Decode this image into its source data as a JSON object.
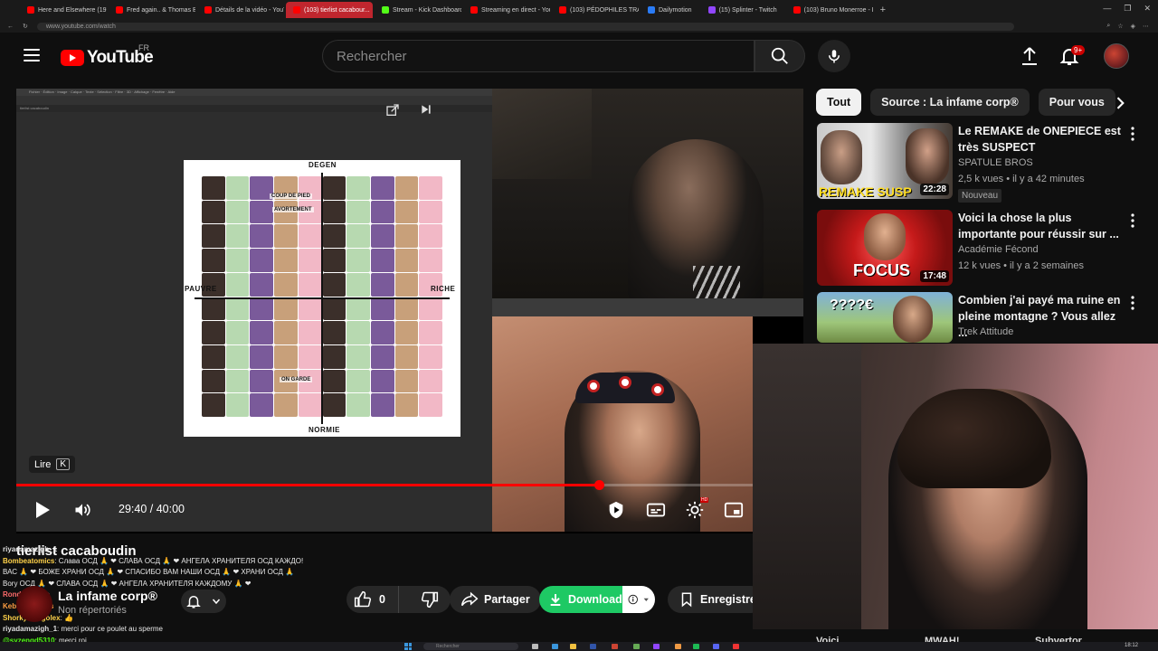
{
  "browser": {
    "tabs": [
      {
        "label": "Here and Elsewhere (197...",
        "icon": "youtube-favicon"
      },
      {
        "label": "Fred again.. & Thomas Ba...",
        "icon": "youtube-favicon"
      },
      {
        "label": "Détails de la vidéo - YouT...",
        "icon": "youtube-favicon"
      },
      {
        "label": "(103) tierlist cacabour...",
        "icon": "youtube-favicon",
        "active": true
      },
      {
        "label": "Stream - Kick Dashboard",
        "icon": "kick-favicon"
      },
      {
        "label": "Streaming en direct - You...",
        "icon": "youtube-favicon"
      },
      {
        "label": "(103) PÉDOPHILES TRANS...",
        "icon": "youtube-favicon"
      },
      {
        "label": "Dailymotion",
        "icon": "dailymotion-favicon"
      },
      {
        "label": "(15) Splinter - Twitch",
        "icon": "twitch-favicon"
      },
      {
        "label": "(103) Bruno Monerroe - Br...",
        "icon": "youtube-favicon"
      }
    ],
    "new_tab": "+",
    "url": "www.youtube.com/watch"
  },
  "header": {
    "logo_text": "YouTube",
    "country": "FR",
    "search_placeholder": "Rechercher",
    "notifications_count": "9+"
  },
  "player": {
    "screen": {
      "tab_text": "tierlist cacaboudin",
      "tier_top": "DEGEN",
      "tier_bottom": "NORMIE",
      "tier_left": "PAUVRE",
      "tier_right": "RICHE",
      "note_1": "COUP DE PIED",
      "note_2": "AVORTEMENT",
      "note_3": "ON GARDE"
    },
    "tooltip": {
      "label": "Lire",
      "key": "K"
    },
    "time_current": "29:40",
    "time_separator": " / ",
    "time_total": "40:00",
    "progress": 0.74,
    "hd": "HD"
  },
  "overlay_title": "tierlist cacaboudin",
  "channel": {
    "name": "La infame corp®",
    "subscribers": "Non répertoriés"
  },
  "chat": [
    {
      "user": "riyadamazigh_1",
      "text": "",
      "color": "#e0e0e0"
    },
    {
      "user": "Bombeatomics",
      "text": ": Слава ОСД 🙏 ❤ СЛАВА ОСД 🙏 ❤ АНГЕЛА ХРАНИТЕЛЯ ОСД КАЖДО!",
      "color": "#ffd24a"
    },
    {
      "user": "",
      "text": "ВАС 🙏 ❤ БОЖЕ ХРАНИ ОСД 🙏 ❤ СПАСИБО ВАМ НАШИ ОСД 🙏 ❤ ХРАНИ ОСД 🙏",
      "color": "#ffd24a"
    },
    {
      "user": "",
      "text": "Bory ОСД 🙏 ❤ СЛАВА ОСД 🙏 ❤ АНГЕЛА ХРАНИТЕЛЯ КАЖДОМУ 🙏 ❤",
      "color": "#ffd24a"
    },
    {
      "user": "Rondelleltalie",
      "text": "",
      "color": "#ff6b6b"
    },
    {
      "user": "Kebabtoujours",
      "text": "",
      "color": "#ff9f43"
    },
    {
      "user": "ShorkyCongolex",
      "text": ": 👍",
      "color": "#ffd24a"
    },
    {
      "user": "riyadamazigh_1",
      "text": ": merci pour ce poulet au sperme",
      "color": "#e0e0e0"
    },
    {
      "user": "@syzengd5310",
      "text": ": merci roi",
      "color": "#53fc18"
    }
  ],
  "actions": {
    "like_count": "0",
    "share": "Partager",
    "download": "Download",
    "save": "Enregistrer"
  },
  "sidebar": {
    "chips": [
      "Tout",
      "Source : La infame corp®",
      "Pour vous"
    ],
    "recommendations": [
      {
        "title": "Le REMAKE de ONEPIECE est très SUSPECT",
        "channel": "SPATULE BROS",
        "meta": "2,5 k vues • il y a 42 minutes",
        "badge": "Nouveau",
        "duration": "22:28",
        "thumb_text": "REMAKE SUSP"
      },
      {
        "title": "Voici la chose la plus importante pour réussir sur ...",
        "channel": "Académie Fécond",
        "meta": "12 k vues • il y a 2 semaines",
        "duration": "17:48",
        "thumb_text": "FOCUS"
      },
      {
        "title": "Combien j'ai payé ma ruine en pleine montagne ? Vous allez ...",
        "channel": "Trek Attitude",
        "meta": "",
        "thumb_text": "????€"
      }
    ]
  },
  "bottom_labels": [
    "Voici",
    "MWAH!",
    "Subvertor"
  ],
  "taskbar": {
    "search": "Rechercher",
    "clock": "18:12"
  },
  "colors": {
    "accent": "#ff0000",
    "download": "#1ec964",
    "background": "#0f0f0f"
  }
}
